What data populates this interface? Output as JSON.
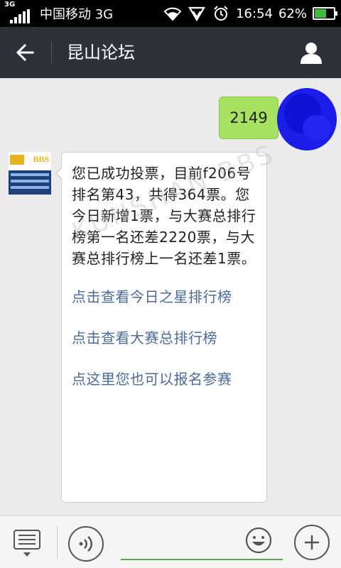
{
  "status_bar": {
    "network_badge": "3G",
    "carrier": "中国移动 3G",
    "time": "16:54",
    "battery_percent": "62%",
    "battery_level": 0.62,
    "icons": [
      "signal-icon",
      "wifi-icon",
      "vpn-icon",
      "alarm-icon",
      "battery-icon"
    ]
  },
  "header": {
    "title": "昆山论坛",
    "back_icon": "back-arrow-icon",
    "profile_icon": "person-icon"
  },
  "chat": {
    "outgoing": {
      "text": "2149"
    },
    "incoming": {
      "avatar_label": "BBS",
      "text": "您已成功投票，目前f206号排名第43，共得364票。您今日新增1票，与大赛总排行榜第一名还差2220票，与大赛总排行榜上一名还差1票。",
      "links": [
        "点击查看今日之星排行榜",
        "点击查看大赛总排行榜",
        "点这里您也可以报名参赛"
      ]
    },
    "watermark": "KUNSHAN BBS"
  },
  "input_bar": {
    "menu_icon": "menu-list-icon",
    "voice_icon": "voice-icon",
    "input_value": "",
    "input_placeholder": "",
    "emoji_icon": "emoji-icon",
    "plus_icon": "plus-icon"
  },
  "colors": {
    "header_bg": "#2e3238",
    "outgoing_bubble": "#a6e15f",
    "link_color": "#4a6b9a",
    "input_underline": "#5ca94a"
  }
}
